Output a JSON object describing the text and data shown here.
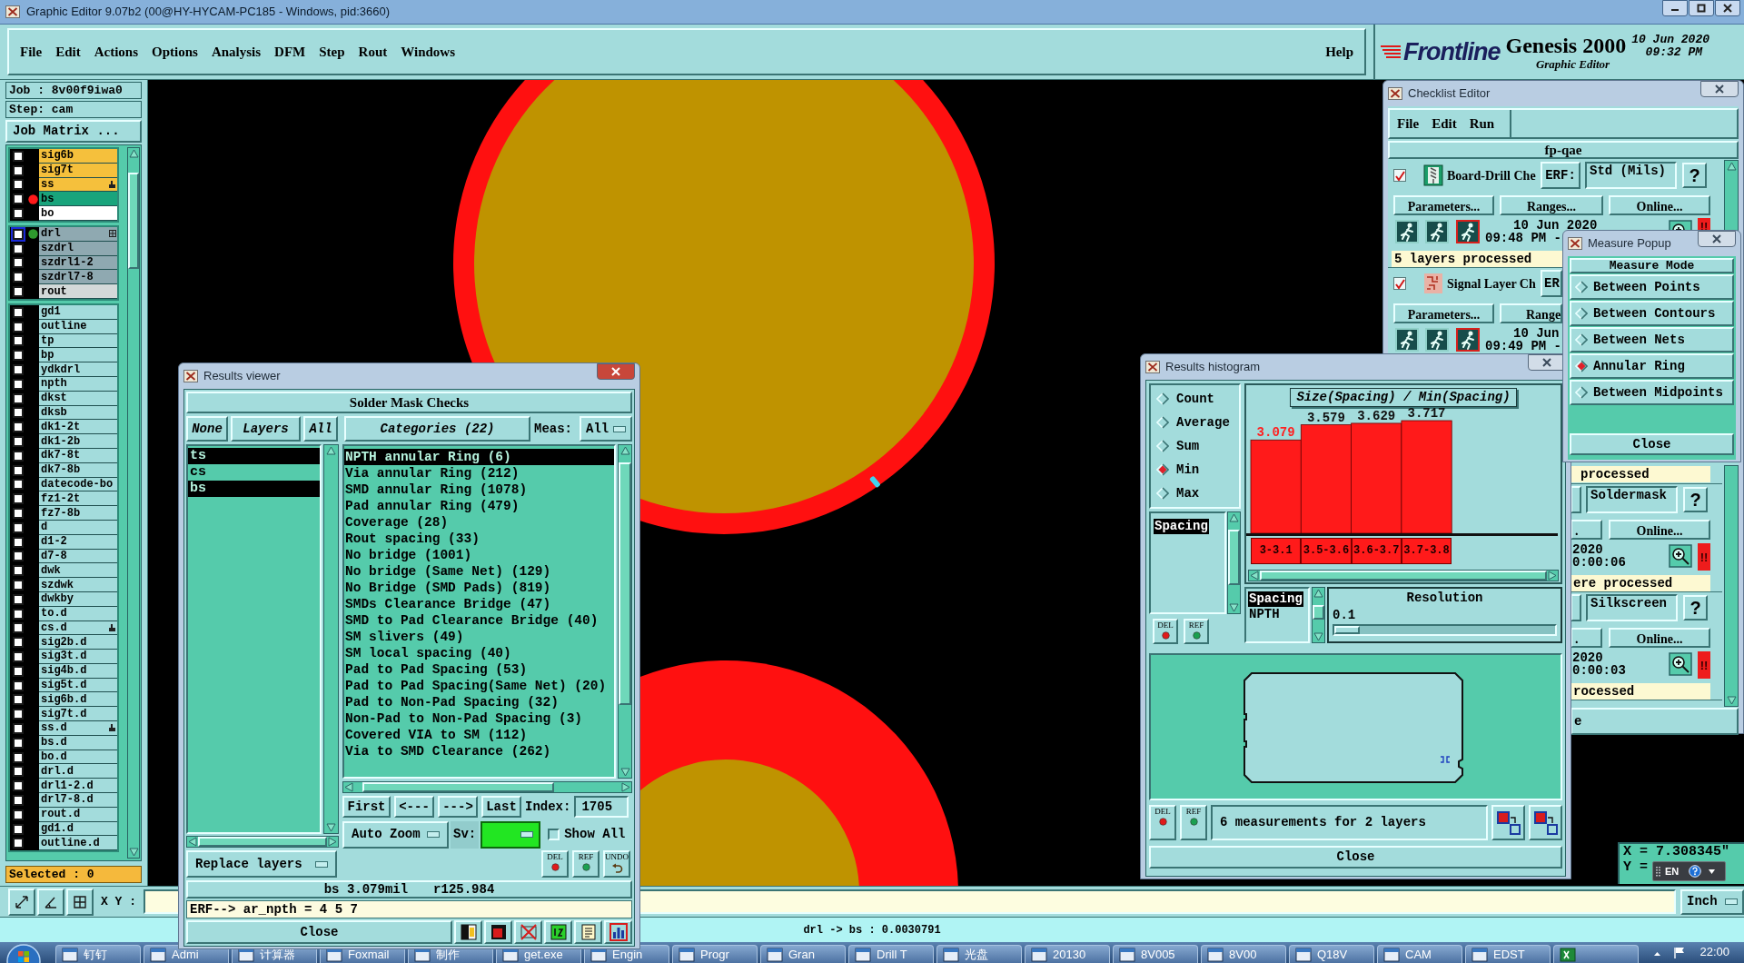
{
  "window": {
    "title": "Graphic Editor 9.07b2 (00@HY-HYCAM-PC185 - Windows, pid:3660)"
  },
  "menu": [
    "File",
    "Edit",
    "Actions",
    "Options",
    "Analysis",
    "DFM",
    "Step",
    "Rout",
    "Windows"
  ],
  "help": "Help",
  "brand": {
    "logo": "Frontline",
    "product": "Genesis 2000",
    "subtitle": "Graphic Editor",
    "date": "10 Jun 2020",
    "time": "09:32 PM"
  },
  "job_panel": {
    "job": "Job : 8v00f9iwa0",
    "step": "Step: cam",
    "matrix_button": "Job Matrix ...",
    "layer_groups": [
      {
        "layers": [
          {
            "name": "sig6b",
            "color": "#f5c03c",
            "checked": false,
            "marked": false,
            "focused": false,
            "expandable": false
          },
          {
            "name": "sig7t",
            "color": "#f5c03c",
            "checked": false,
            "marked": false,
            "focused": false,
            "expandable": false
          },
          {
            "name": "ss",
            "color": "#f5c03c",
            "checked": false,
            "marked": true,
            "focused": false,
            "expandable": false
          },
          {
            "name": "bs",
            "color": "#19a47c",
            "checked": false,
            "marked": false,
            "focused": false,
            "expandable": false,
            "dot": {
              "color": "#ff1a1a"
            }
          },
          {
            "name": "bo",
            "color": "#ffffff",
            "checked": false,
            "marked": false,
            "focused": false,
            "expandable": false
          }
        ]
      },
      {
        "layers": [
          {
            "name": "drl",
            "color": "#8fa9b1",
            "checked": false,
            "marked": false,
            "focused": true,
            "expandable": true,
            "dot": {
              "color": "#2e9a2e"
            }
          },
          {
            "name": "szdrl",
            "color": "#8fa9b1",
            "checked": false,
            "marked": false,
            "focused": false,
            "expandable": false
          },
          {
            "name": "szdrl1-2",
            "color": "#8fa9b1",
            "checked": false,
            "marked": false,
            "focused": false,
            "expandable": false
          },
          {
            "name": "szdrl7-8",
            "color": "#8fa9b1",
            "checked": false,
            "marked": false,
            "focused": false,
            "expandable": false
          },
          {
            "name": "rout",
            "color": "#d3d9d9",
            "checked": false,
            "marked": false,
            "focused": false,
            "expandable": false
          }
        ]
      },
      {
        "layers": [
          {
            "name": "gd1",
            "color": "#a3dcdc",
            "checked": false,
            "marked": false,
            "focused": false,
            "expandable": false
          },
          {
            "name": "outline",
            "color": "#a3dcdc",
            "checked": false,
            "marked": false,
            "focused": false,
            "expandable": false
          },
          {
            "name": "tp",
            "color": "#a3dcdc",
            "checked": false,
            "marked": false,
            "focused": false,
            "expandable": false
          },
          {
            "name": "bp",
            "color": "#a3dcdc",
            "checked": false,
            "marked": false,
            "focused": false,
            "expandable": false
          },
          {
            "name": "ydkdrl",
            "color": "#a3dcdc",
            "checked": false,
            "marked": false,
            "focused": false,
            "expandable": false
          },
          {
            "name": "npth",
            "color": "#a3dcdc",
            "checked": false,
            "marked": false,
            "focused": false,
            "expandable": false
          },
          {
            "name": "dkst",
            "color": "#a3dcdc",
            "checked": false,
            "marked": false,
            "focused": false,
            "expandable": false
          },
          {
            "name": "dksb",
            "color": "#a3dcdc",
            "checked": false,
            "marked": false,
            "focused": false,
            "expandable": false
          },
          {
            "name": "dk1-2t",
            "color": "#a3dcdc",
            "checked": false,
            "marked": false,
            "focused": false,
            "expandable": false
          },
          {
            "name": "dk1-2b",
            "color": "#a3dcdc",
            "checked": false,
            "marked": false,
            "focused": false,
            "expandable": false
          },
          {
            "name": "dk7-8t",
            "color": "#a3dcdc",
            "checked": false,
            "marked": false,
            "focused": false,
            "expandable": false
          },
          {
            "name": "dk7-8b",
            "color": "#a3dcdc",
            "checked": false,
            "marked": false,
            "focused": false,
            "expandable": false
          },
          {
            "name": "datecode-bo",
            "color": "#a3dcdc",
            "checked": false,
            "marked": false,
            "focused": false,
            "expandable": false
          },
          {
            "name": "fz1-2t",
            "color": "#a3dcdc",
            "checked": false,
            "marked": false,
            "focused": false,
            "expandable": false
          },
          {
            "name": "fz7-8b",
            "color": "#a3dcdc",
            "checked": false,
            "marked": false,
            "focused": false,
            "expandable": false
          },
          {
            "name": "d",
            "color": "#a3dcdc",
            "checked": false,
            "marked": false,
            "focused": false,
            "expandable": false
          },
          {
            "name": "d1-2",
            "color": "#a3dcdc",
            "checked": false,
            "marked": false,
            "focused": false,
            "expandable": false
          },
          {
            "name": "d7-8",
            "color": "#a3dcdc",
            "checked": false,
            "marked": false,
            "focused": false,
            "expandable": false
          },
          {
            "name": "dwk",
            "color": "#a3dcdc",
            "checked": false,
            "marked": false,
            "focused": false,
            "expandable": false
          },
          {
            "name": "szdwk",
            "color": "#a3dcdc",
            "checked": false,
            "marked": false,
            "focused": false,
            "expandable": false
          },
          {
            "name": "dwkby",
            "color": "#a3dcdc",
            "checked": false,
            "marked": false,
            "focused": false,
            "expandable": false
          },
          {
            "name": "to.d",
            "color": "#a3dcdc",
            "checked": false,
            "marked": false,
            "focused": false,
            "expandable": false
          },
          {
            "name": "cs.d",
            "color": "#a3dcdc",
            "checked": false,
            "marked": true,
            "focused": false,
            "expandable": false
          },
          {
            "name": "sig2b.d",
            "color": "#a3dcdc",
            "checked": false,
            "marked": false,
            "focused": false,
            "expandable": false
          },
          {
            "name": "sig3t.d",
            "color": "#a3dcdc",
            "checked": false,
            "marked": false,
            "focused": false,
            "expandable": false
          },
          {
            "name": "sig4b.d",
            "color": "#a3dcdc",
            "checked": false,
            "marked": false,
            "focused": false,
            "expandable": false
          },
          {
            "name": "sig5t.d",
            "color": "#a3dcdc",
            "checked": false,
            "marked": false,
            "focused": false,
            "expandable": false
          },
          {
            "name": "sig6b.d",
            "color": "#a3dcdc",
            "checked": false,
            "marked": false,
            "focused": false,
            "expandable": false
          },
          {
            "name": "sig7t.d",
            "color": "#a3dcdc",
            "checked": false,
            "marked": false,
            "focused": false,
            "expandable": false
          },
          {
            "name": "ss.d",
            "color": "#a3dcdc",
            "checked": false,
            "marked": true,
            "focused": false,
            "expandable": false
          },
          {
            "name": "bs.d",
            "color": "#a3dcdc",
            "checked": false,
            "marked": false,
            "focused": false,
            "expandable": false
          },
          {
            "name": "bo.d",
            "color": "#a3dcdc",
            "checked": false,
            "marked": false,
            "focused": false,
            "expandable": false
          },
          {
            "name": "drl.d",
            "color": "#a3dcdc",
            "checked": false,
            "marked": false,
            "focused": false,
            "expandable": false
          },
          {
            "name": "drl1-2.d",
            "color": "#a3dcdc",
            "checked": false,
            "marked": false,
            "focused": false,
            "expandable": false
          },
          {
            "name": "drl7-8.d",
            "color": "#a3dcdc",
            "checked": false,
            "marked": false,
            "focused": false,
            "expandable": false
          },
          {
            "name": "rout.d",
            "color": "#a3dcdc",
            "checked": false,
            "marked": false,
            "focused": false,
            "expandable": false
          },
          {
            "name": "gd1.d",
            "color": "#a3dcdc",
            "checked": false,
            "marked": false,
            "focused": false,
            "expandable": false
          },
          {
            "name": "outline.d",
            "color": "#a3dcdc",
            "checked": false,
            "marked": false,
            "focused": false,
            "expandable": false
          }
        ]
      }
    ],
    "selected": "Selected : 0"
  },
  "coordinate_bar": {
    "label": "X Y :",
    "units": "Inch"
  },
  "cursor_readout": {
    "x": "X = 7.308345\"",
    "y": "Y =",
    "language": "EN"
  },
  "status_line": "drl -> bs : 0.0030791",
  "results_viewer": {
    "title": "Results viewer",
    "header": "Solder Mask Checks",
    "layer_buttons": [
      "None",
      "Layers",
      "All"
    ],
    "categories_button": "Categories (22)",
    "meas_label": "Meas:",
    "meas_value": "All",
    "layers": [
      {
        "name": "ts",
        "selected": true
      },
      {
        "name": "cs",
        "selected": false
      },
      {
        "name": "bs",
        "selected": true
      }
    ],
    "categories": [
      {
        "label": "NPTH annular Ring (6)",
        "selected": true
      },
      {
        "label": "Via annular Ring (212)",
        "selected": false
      },
      {
        "label": "SMD annular Ring (1078)",
        "selected": false
      },
      {
        "label": "Pad annular Ring (479)",
        "selected": false
      },
      {
        "label": "Coverage (28)",
        "selected": false
      },
      {
        "label": "Rout spacing (33)",
        "selected": false
      },
      {
        "label": "No bridge (1001)",
        "selected": false
      },
      {
        "label": "No bridge (Same Net) (129)",
        "selected": false
      },
      {
        "label": "No Bridge (SMD Pads) (819)",
        "selected": false
      },
      {
        "label": "SMDs Clearance Bridge (47)",
        "selected": false
      },
      {
        "label": "SMD to Pad Clearance Bridge (40)",
        "selected": false
      },
      {
        "label": "SM slivers (49)",
        "selected": false
      },
      {
        "label": "SM local spacing (40)",
        "selected": false
      },
      {
        "label": "Pad to Pad Spacing (53)",
        "selected": false
      },
      {
        "label": "Pad to Pad Spacing(Same Net) (20)",
        "selected": false
      },
      {
        "label": "Pad to Non-Pad Spacing (32)",
        "selected": false
      },
      {
        "label": "Non-Pad to Non-Pad Spacing (3)",
        "selected": false
      },
      {
        "label": "Covered VIA to SM (112)",
        "selected": false
      },
      {
        "label": "Via to SMD Clearance (262)",
        "selected": false
      }
    ],
    "nav_buttons": [
      "First",
      "<---",
      "--->",
      "Last"
    ],
    "index_label": "Index:",
    "index_value": "1705",
    "zoom_mode": "Auto Zoom",
    "sv_label": "Sv:",
    "show_all": {
      "label": "Show All",
      "checked": false
    },
    "replace_mode": "Replace layers",
    "action_buttons": [
      {
        "label": "DEL",
        "kind": "delete"
      },
      {
        "label": "REF",
        "kind": "reference"
      },
      {
        "label": "UNDO",
        "kind": "undo"
      }
    ],
    "measurement": [
      "bs 3.079mil",
      "r125.984"
    ],
    "command_output": "ERF--> ar_npth = 4 5 7",
    "close": "Close"
  },
  "results_histogram": {
    "title": "Results histogram",
    "modes": [
      {
        "label": "Count",
        "selected": false
      },
      {
        "label": "Average",
        "selected": false
      },
      {
        "label": "Sum",
        "selected": false
      },
      {
        "label": "Min",
        "selected": true
      },
      {
        "label": "Max",
        "selected": false
      }
    ],
    "measure_types": [
      {
        "label": "Spacing",
        "selected": true
      }
    ],
    "side_buttons": [
      {
        "label": "DEL",
        "kind": "delete"
      },
      {
        "label": "REF",
        "kind": "reference"
      }
    ],
    "chart_data": {
      "type": "bar",
      "title": "Size(Spacing) / Min(Spacing)",
      "categories": [
        "3-3.1",
        "3.5-3.6",
        "3.6-3.7",
        "3.7-3.8"
      ],
      "series": [
        {
          "color": "#ff1a1a",
          "values": [
            3.079,
            3.579,
            3.629,
            3.717
          ]
        }
      ],
      "data_labels": true
    },
    "bins": [
      {
        "selected": true
      },
      {
        "selected": false
      },
      {
        "selected": false
      },
      {
        "selected": false
      }
    ],
    "fields": [
      {
        "label": "Spacing",
        "selected": true
      },
      {
        "label": "NPTH",
        "selected": false
      }
    ],
    "resolution": {
      "label": "Resolution",
      "value": "0.1",
      "level": 0
    },
    "bottom_buttons": [
      {
        "label": "DEL",
        "kind": "delete"
      },
      {
        "label": "REF",
        "kind": "reference"
      }
    ],
    "summary": "6 measurements for 2 layers",
    "close": "Close"
  },
  "checklist_editor": {
    "title": "Checklist Editor",
    "menu": [
      "File",
      "Edit",
      "Run"
    ],
    "name": "fp-qae",
    "checks": [
      {
        "kind": "open",
        "checked": true,
        "name": "Board-Drill Che",
        "erf_button": "ERF:",
        "erf": "Std (Mils)",
        "help": "?",
        "buttons": [
          "Parameters...",
          "Ranges...",
          "Online..."
        ],
        "date": "10 Jun 2020",
        "time": "09:48 PM -",
        "alert": "!!",
        "status": "5 layers processed"
      },
      {
        "kind": "covered",
        "checked": true,
        "name": "Signal Layer Ch",
        "erf_button": "ER",
        "buttons": [
          "Parameters...",
          "Range"
        ],
        "date": "10 Jun",
        "time": "09:49 PM -"
      },
      {
        "kind": "status",
        "status": "processed"
      },
      {
        "kind": "side",
        "erf": "Soldermask",
        "help": "?",
        "buttons": [
          ".",
          "Online..."
        ],
        "date": "2020",
        "time": "0:00:06",
        "alert": "!!",
        "status": "ere processed"
      },
      {
        "kind": "side",
        "erf": "Silkscreen",
        "help": "?",
        "buttons": [
          ".",
          "Online..."
        ],
        "date": "2020",
        "time": "0:00:03",
        "alert": "!!",
        "status": "rocessed"
      }
    ],
    "close": "e"
  },
  "measure_popup": {
    "title": "Measure Popup",
    "header": "Measure Mode",
    "modes": [
      {
        "label": "Between Points",
        "selected": false
      },
      {
        "label": "Between Contours",
        "selected": false
      },
      {
        "label": "Between Nets",
        "selected": false
      },
      {
        "label": "Annular Ring",
        "selected": true
      },
      {
        "label": "Between Midpoints",
        "selected": false
      }
    ],
    "close": "Close"
  },
  "taskbar": {
    "items": [
      "钉钉",
      "Admi",
      "计算器",
      "Foxmail",
      "制作",
      "get.exe",
      "Engin",
      "Progr",
      "Gran",
      "Drill T",
      "光盘",
      "20130",
      "8V005",
      "8V00",
      "Q18V",
      "CAM",
      "EDST"
    ],
    "clock": "22:00"
  }
}
